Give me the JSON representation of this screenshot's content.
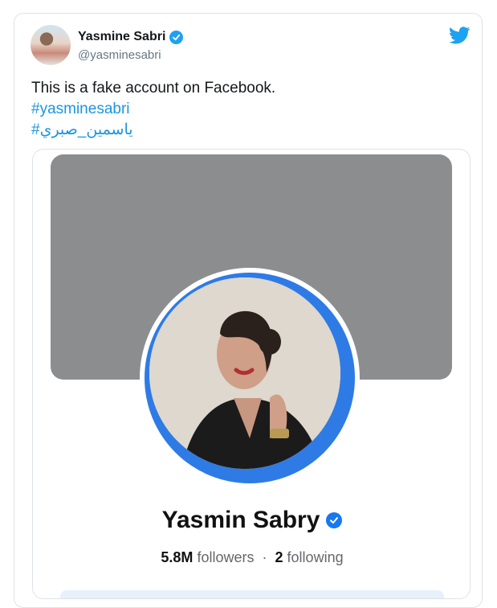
{
  "tweet": {
    "author": {
      "name": "Yasmine Sabri",
      "handle": "@yasminesabri",
      "verified": true
    },
    "text": "This is a fake account on Facebook.",
    "hashtags": [
      "#yasminesabri",
      "#ياسمين_صبري"
    ],
    "icons": {
      "brand": "twitter-bird-icon",
      "verified": "verified-badge-icon"
    },
    "colors": {
      "link": "#1b95e0",
      "twitter_blue": "#1da1f2"
    }
  },
  "embedded_profile": {
    "name": "Yasmin Sabry",
    "verified": true,
    "followers_count": "5.8M",
    "followers_label": "followers",
    "separator": "·",
    "following_count": "2",
    "following_label": "following",
    "colors": {
      "cover": "#8c8d8f",
      "ring": "#2e7be6",
      "badge": "#1877f2"
    }
  }
}
